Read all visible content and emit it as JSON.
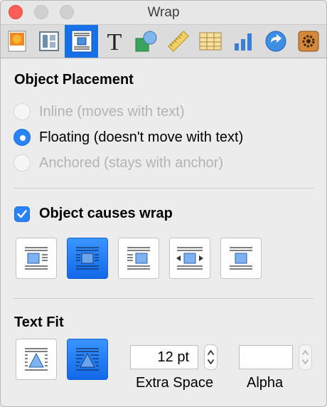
{
  "window": {
    "title": "Wrap"
  },
  "toolbar": {
    "tabs": [
      {
        "name": "document-tab",
        "icon": "document-icon"
      },
      {
        "name": "layout-tab",
        "icon": "layout-icon"
      },
      {
        "name": "wrap-tab",
        "icon": "wrap-icon",
        "selected": true
      },
      {
        "name": "text-tab",
        "icon": "text-icon"
      },
      {
        "name": "graphic-tab",
        "icon": "graphic-icon"
      },
      {
        "name": "metrics-tab",
        "icon": "ruler-icon"
      },
      {
        "name": "table-tab",
        "icon": "table-icon"
      },
      {
        "name": "chart-tab",
        "icon": "chart-icon"
      },
      {
        "name": "link-tab",
        "icon": "link-icon"
      },
      {
        "name": "quicktime-tab",
        "icon": "gear-icon"
      }
    ]
  },
  "placement": {
    "heading": "Object Placement",
    "options": [
      {
        "label": "Inline (moves with text)",
        "enabled": false,
        "selected": false
      },
      {
        "label": "Floating (doesn't move with text)",
        "enabled": true,
        "selected": true
      },
      {
        "label": "Anchored (stays with anchor)",
        "enabled": false,
        "selected": false
      }
    ]
  },
  "wrap": {
    "checkbox_label": "Object causes wrap",
    "checked": true,
    "styles": [
      "wrap-left",
      "wrap-around",
      "wrap-right",
      "wrap-both-sides",
      "wrap-none"
    ],
    "selected_style": "wrap-around"
  },
  "text_fit": {
    "heading": "Text Fit",
    "options": [
      "fit-rectangle",
      "fit-shape"
    ],
    "selected": "fit-shape",
    "extra_space_value": "12 pt",
    "extra_space_label": "Extra Space",
    "alpha_value": "",
    "alpha_label": "Alpha"
  },
  "colors": {
    "accent": "#1671e6",
    "disabled_text": "#b3b3b3"
  }
}
